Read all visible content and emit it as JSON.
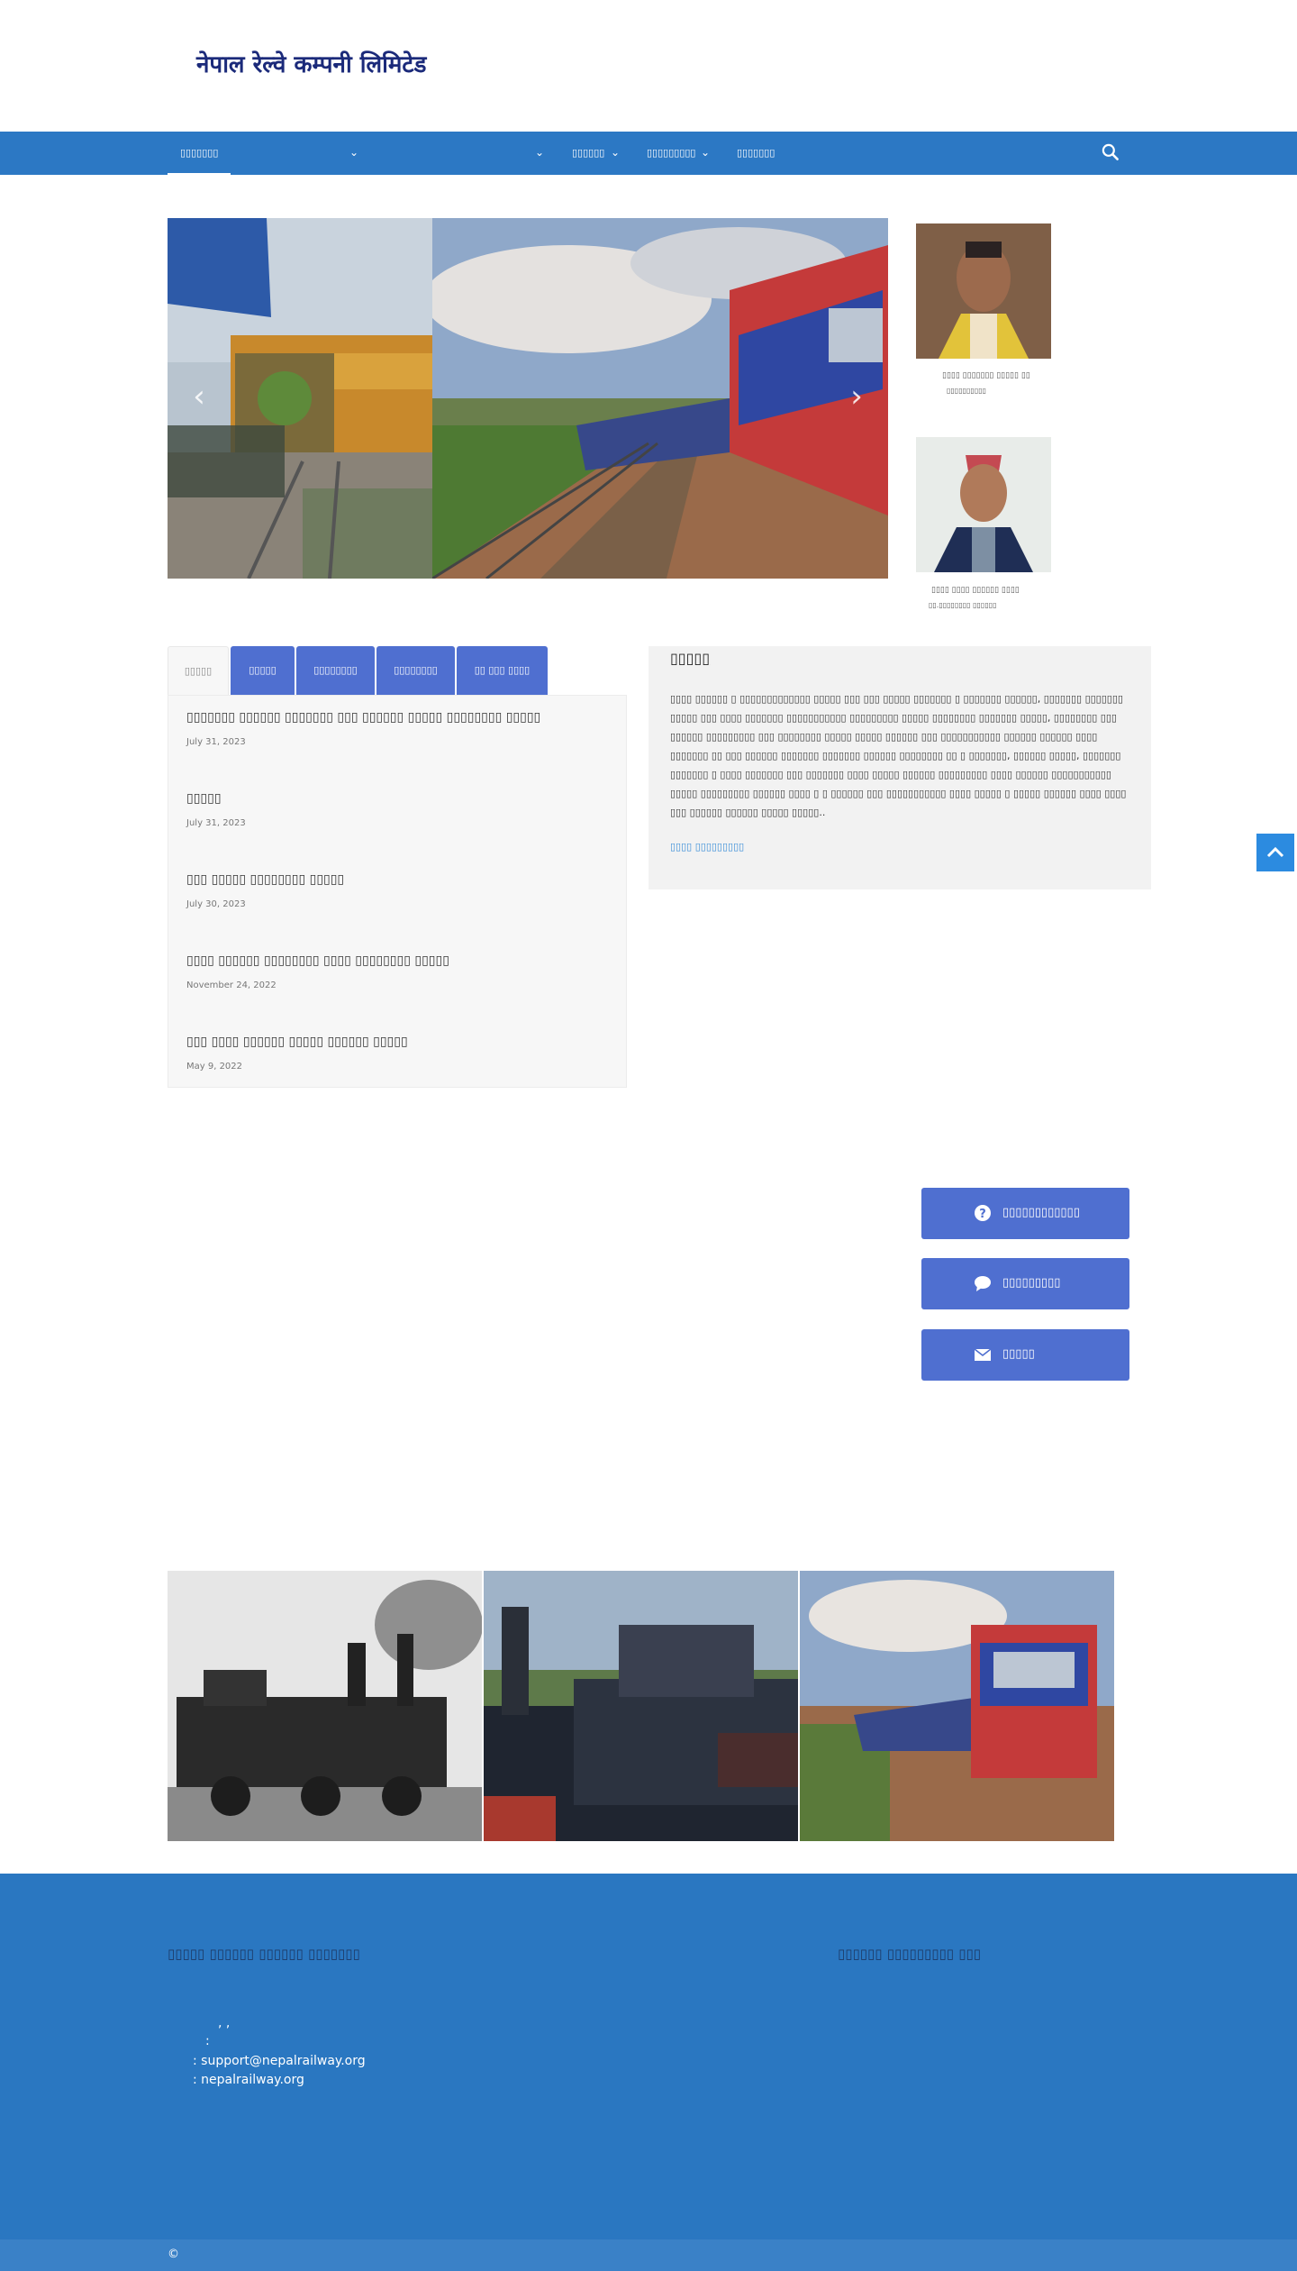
{
  "header": {
    "site_title": "नेपाल रेल्वे कम्पनी लिमिटेड"
  },
  "nav": {
    "items": [
      "▯▯▯▯▯▯▯",
      "▯▯▯▯▯▯",
      "▯▯▯▯▯▯▯▯▯",
      "▯▯▯▯▯▯▯"
    ],
    "active_index": 0
  },
  "slider": {
    "caption": "▯▯▯ ▯▯▯▯▯▯"
  },
  "officials": [
    {
      "name": "▯▯▯▯ ▯▯▯▯▯▯▯ ▯▯▯▯▯ ▯▯",
      "title": "▯▯▯▯▯▯▯▯▯▯"
    },
    {
      "name": "▯▯▯▯ ▯▯▯▯ ▯▯▯▯▯▯ ▯▯▯▯",
      "title": "▯▯.▯▯▯▯▯▯▯▯ ▯▯▯▯▯▯"
    }
  ],
  "tabs": {
    "labels": [
      "▯▯▯▯▯",
      "▯▯▯▯▯",
      "▯▯▯▯▯▯▯▯",
      "▯▯▯▯▯▯▯▯",
      "▯▯ ▯▯▯ ▯▯▯▯"
    ],
    "active_index": 0,
    "posts": [
      {
        "title": "▯▯▯▯▯▯▯ ▯▯▯▯▯▯ ▯▯▯▯▯▯▯ ▯▯▯ ▯▯▯▯▯▯ ▯▯▯▯▯ ▯▯▯▯▯▯▯▯ ▯▯▯▯▯",
        "date": "July 31, 2023"
      },
      {
        "title": "▯▯▯▯▯",
        "date": "July 31, 2023"
      },
      {
        "title": "▯▯▯ ▯▯▯▯▯ ▯▯▯▯▯▯▯▯ ▯▯▯▯▯",
        "date": "July 30, 2023"
      },
      {
        "title": "▯▯▯▯ ▯▯▯▯▯▯ ▯▯▯▯▯▯▯▯ ▯▯▯▯ ▯▯▯▯▯▯▯▯ ▯▯▯▯▯",
        "date": "November 24, 2022"
      },
      {
        "title": "▯▯▯ ▯▯▯▯ ▯▯▯▯▯▯ ▯▯▯▯▯ ▯▯▯▯▯▯ ▯▯▯▯▯",
        "date": "May 9, 2022"
      }
    ]
  },
  "intro": {
    "heading": "▯▯▯▯▯",
    "text": "▯▯▯▯ ▯▯▯▯▯▯ ▯ ▯▯▯▯▯▯▯▯▯▯▯▯▯ ▯▯▯▯▯ ▯▯▯ ▯▯▯ ▯▯▯▯▯ ▯▯▯▯▯▯▯ ▯ ▯▯▯▯▯▯▯ ▯▯▯▯▯▯, ▯▯▯▯▯▯▯ ▯▯▯▯▯▯▯ ▯▯▯▯▯ ▯▯▯ ▯▯▯▯ ▯▯▯▯▯▯▯ ▯▯▯▯▯▯▯▯▯▯▯ ▯▯▯▯▯▯▯▯▯ ▯▯▯▯▯ ▯▯▯▯▯▯▯▯ ▯▯▯▯▯▯▯ ▯▯▯▯▯, ▯▯▯▯▯▯▯▯ ▯▯▯ ▯▯▯▯▯▯ ▯▯▯▯▯▯▯▯▯ ▯▯▯ ▯▯▯▯▯▯▯▯ ▯▯▯▯▯ ▯▯▯▯▯ ▯▯▯▯▯▯ ▯▯▯ ▯▯▯▯▯▯▯▯▯▯▯ ▯▯▯▯▯▯ ▯▯▯▯▯▯ ▯▯▯▯ ▯▯▯▯▯▯▯ ▯▯ ▯▯▯ ▯▯▯▯▯▯ ▯▯▯▯▯▯▯ ▯▯▯▯▯▯▯ ▯▯▯▯▯▯ ▯▯▯▯▯▯▯▯ ▯▯ ▯ ▯▯▯▯▯▯▯, ▯▯▯▯▯▯ ▯▯▯▯▯, ▯▯▯▯▯▯▯ ▯▯▯▯▯▯▯ ▯ ▯▯▯▯ ▯▯▯▯▯▯▯ ▯▯▯ ▯▯▯▯▯▯▯ ▯▯▯▯ ▯▯▯▯▯ ▯▯▯▯▯▯ ▯▯▯▯▯▯▯▯▯ ▯▯▯▯ ▯▯▯▯▯▯ ▯▯▯▯▯▯▯▯▯▯▯ ▯▯▯▯▯ ▯▯▯▯▯▯▯▯▯  ▯▯▯▯▯▯ ▯▯▯▯ ▯ ▯ ▯▯▯▯▯▯ ▯▯▯ ▯▯▯▯▯▯▯▯▯▯▯ ▯▯▯▯ ▯▯▯▯▯ ▯ ▯▯▯▯▯ ▯▯▯▯▯▯ ▯▯▯▯ ▯▯▯▯ ▯▯▯ ▯▯▯▯▯▯ ▯▯▯▯▯▯ ▯▯▯▯▯ ▯▯▯▯▯..",
    "link": "▯▯▯▯ ▯▯▯▯▯▯▯▯▯"
  },
  "actions": [
    {
      "label": "▯▯▯▯▯▯▯▯▯▯▯▯",
      "icon": "question-circle-icon"
    },
    {
      "label": "▯▯▯▯▯▯▯▯▯",
      "icon": "comment-icon"
    },
    {
      "label": "▯▯▯▯▯",
      "icon": "envelope-icon"
    }
  ],
  "footer": {
    "left_heading": "▯▯▯▯▯ ▯▯▯▯▯▯ ▯▯▯▯▯▯ ▯▯▯▯▯▯▯",
    "right_heading": "▯▯▯▯▯▯ ▯▯▯▯▯▯▯▯▯ ▯▯▯",
    "address_line": ",          ,",
    "phone_line": ":",
    "email_line": ": support@nepalrailway.org",
    "website_line": ": nepalrailway.org",
    "copyright": "©"
  },
  "colors": {
    "nav": "#2c78c4",
    "accent_button": "#4f6fd0",
    "footer": "#2a77c1",
    "brand_text": "#1b2a7a"
  }
}
